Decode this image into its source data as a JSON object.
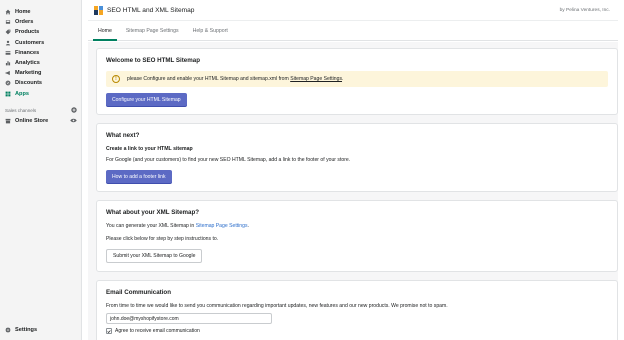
{
  "sidebar": {
    "items": [
      {
        "label": "Home",
        "icon": "home-icon"
      },
      {
        "label": "Orders",
        "icon": "orders-icon"
      },
      {
        "label": "Products",
        "icon": "products-icon"
      },
      {
        "label": "Customers",
        "icon": "customers-icon"
      },
      {
        "label": "Finances",
        "icon": "finances-icon"
      },
      {
        "label": "Analytics",
        "icon": "analytics-icon"
      },
      {
        "label": "Marketing",
        "icon": "marketing-icon"
      },
      {
        "label": "Discounts",
        "icon": "discounts-icon"
      },
      {
        "label": "Apps",
        "icon": "apps-icon",
        "active": true
      }
    ],
    "sales_channels_label": "Sales channels",
    "online_store_label": "Online Store",
    "settings_label": "Settings"
  },
  "app": {
    "title": "SEO HTML and XML Sitemap",
    "vendor": "by Pelina Ventures, Inc."
  },
  "tabs": [
    "Home",
    "Sitemap Page Settings",
    "Help & Support"
  ],
  "welcome": {
    "title": "Welcome to SEO HTML Sitemap",
    "banner_text": "please Configure and enable your HTML Sitemap and sitemap.xml from",
    "banner_link": "Sitemap Page Settings",
    "banner_end": ".",
    "button": "Configure your HTML Sitemap"
  },
  "next": {
    "title": "What next?",
    "subtitle": "Create a link to your HTML sitemap",
    "text": "For Google (and your customers) to find your new SEO HTML Sitemap, add a link to the footer of your store.",
    "button": "How to add a footer link"
  },
  "xml": {
    "title": "What about your XML Sitemap?",
    "text_prefix": "You can generate your XML Sitemap in",
    "text_link": "Sitemap Page Settings",
    "text_suffix": ".",
    "text2": "Please click below for step by step instructions to.",
    "button": "Submit your XML Sitemap to Google"
  },
  "email": {
    "title": "Email Communication",
    "text": "From time to time we would like to send you communication regarding important updates, new features and our new products. We promise not to spam.",
    "input_value": "john.doe@myshopifystore.com",
    "checkbox_label": "Agree to receive email communication",
    "checked": true
  },
  "colors": {
    "primary_button": "#5c6ac4",
    "active_tab": "#008060",
    "banner": "#fdf5db",
    "link": "#2c6ecb"
  }
}
